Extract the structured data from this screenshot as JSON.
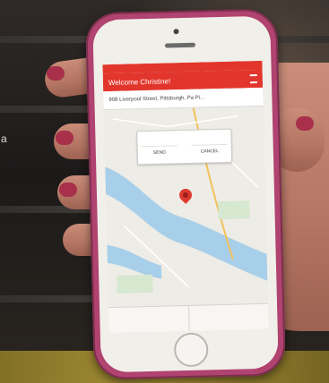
{
  "side_char": "a",
  "status_bar": {
    "left": "",
    "center": "",
    "right": ""
  },
  "app": {
    "title": "Welcome Christine!",
    "menu_icon": "menu-icon"
  },
  "address": "908 Liverpool Street, Pittsburgh, Pa Pi...",
  "map": {
    "info_window": {
      "title": "",
      "set_label": "SEND",
      "cancel_label": "CANCEL"
    },
    "pin_icon": "map-pin-icon"
  },
  "tabs": [
    {
      "label": ""
    },
    {
      "label": ""
    }
  ],
  "colors": {
    "case": "#b0436f",
    "app_bar": "#e2362c",
    "water": "#a8cfe9",
    "pin": "#dd3a30"
  }
}
